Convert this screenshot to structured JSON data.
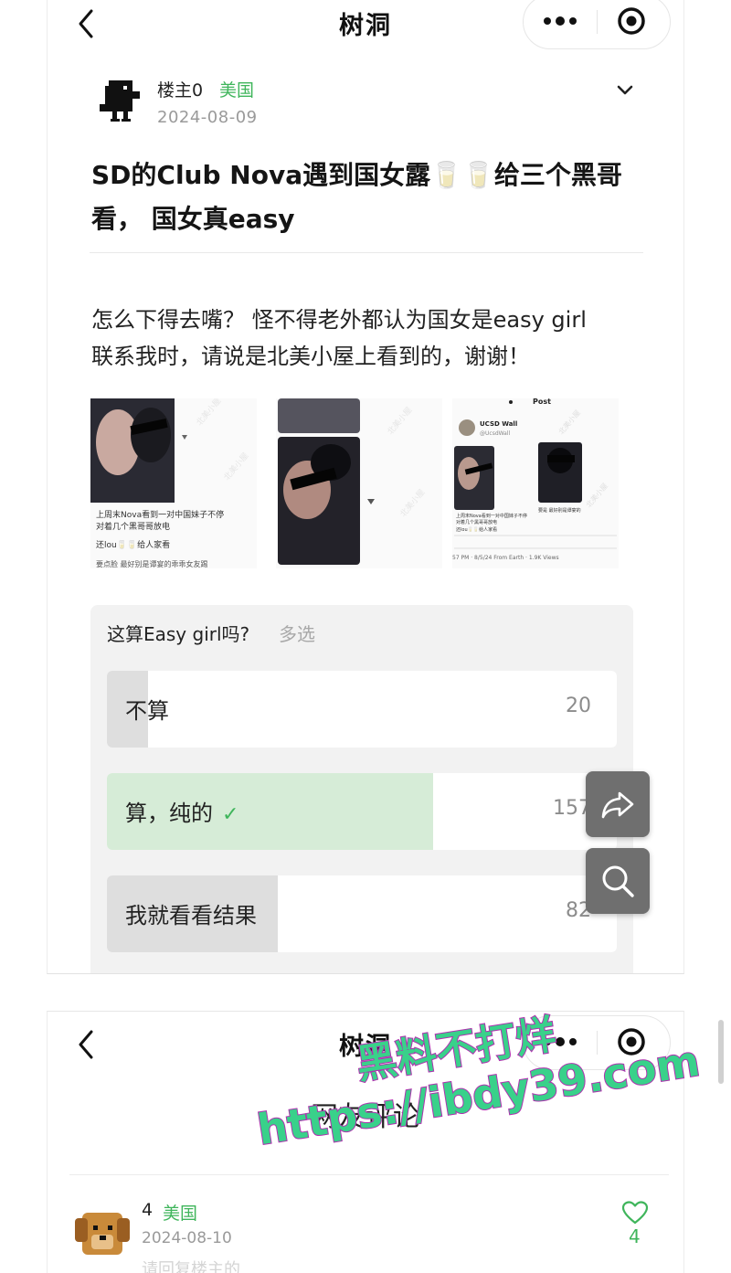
{
  "screen1": {
    "nav": {
      "title": "树洞"
    },
    "post": {
      "author": "楼主0",
      "region": "美国",
      "date": "2024-08-09",
      "title": " SD的Club Nova遇到国女露🥛🥛给三个黑哥看， 国女真easy",
      "body_line1": "怎么下得去嘴？ 怪不得老外都认为国女是easy girl",
      "body_line2": "联系我时，请说是北美小屋上看到的，谢谢！",
      "images": [
        {
          "caption_line1": "上周末Nova看到一对中国妹子不停",
          "caption_line2": "对着几个黑哥哥放电",
          "caption_line3": "还lou🥛🥛给人家看",
          "caption_line4": "要点脸 最好别是谭宴的乖乖女友踢"
        },
        {},
        {
          "header": "Post",
          "account_name": "UCSD Wall",
          "account_handle": "@UcsdWall",
          "caption_line1": "上周末Nova看到一对中国妹子不停",
          "caption_line2": "对着几个黑哥哥放电",
          "caption_line3": "还lou🥛🥛给人家看",
          "side_caption": "要是 最好别是谭宴的",
          "footer": "57 PM · 8/5/24 From Earth · 1.9K Views"
        }
      ]
    },
    "poll": {
      "question": "这算Easy girl吗?",
      "type_label": "多选",
      "options": [
        {
          "label": "不算",
          "count": "20",
          "fill_fraction": 0.08,
          "selected": false
        },
        {
          "label": "算，纯的",
          "count": "157",
          "fill_fraction": 0.64,
          "selected": true
        },
        {
          "label": "我就看看结果",
          "count": "82",
          "fill_fraction": 0.335,
          "selected": false
        }
      ],
      "check_mark": "✓"
    },
    "fab": {
      "share_icon": "share-icon",
      "search_icon": "search-icon"
    }
  },
  "screen2": {
    "nav": {
      "title": "树洞"
    },
    "section_title": "网友评论",
    "comment": {
      "author": "4",
      "region": "美国",
      "date": "2024-08-10",
      "likes": "4",
      "preview": "请回复楼主的"
    }
  },
  "watermark": {
    "line1": "黑料不打烊",
    "line2": "https://ibdy39.com"
  },
  "colors": {
    "accent_green": "#3fb55b",
    "poll_bg": "#f2f2f2",
    "poll_selected_fill": "#d6ecd7",
    "poll_fill": "#dedede",
    "fab_bg": "#6f6f6f"
  }
}
